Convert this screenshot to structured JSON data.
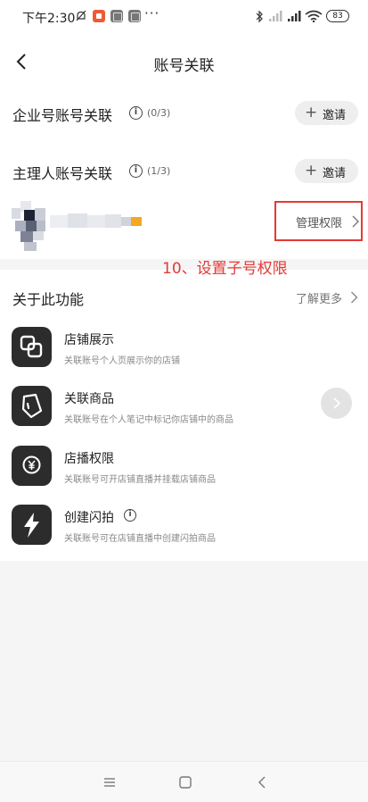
{
  "status_bar": {
    "time": "下午2:30",
    "more": "···",
    "battery": "83"
  },
  "header": {
    "title": "账号关联"
  },
  "enterprise": {
    "title": "企业号账号关联",
    "count": "(0/3)",
    "invite_label": "邀请"
  },
  "manager": {
    "title": "主理人账号关联",
    "count": "(1/3)",
    "invite_label": "邀请",
    "manage_label": "管理权限"
  },
  "annotation": "10、设置子号权限",
  "about": {
    "title": "关于此功能",
    "learn_more": "了解更多",
    "features": [
      {
        "title": "店铺展示",
        "desc": "关联账号个人页展示你的店铺",
        "icon": "overlapping-squares-icon"
      },
      {
        "title": "关联商品",
        "desc": "关联账号在个人笔记中标记你店铺中的商品",
        "icon": "tag-icon"
      },
      {
        "title": "店播权限",
        "desc": "关联账号可开店铺直播并挂载店铺商品",
        "icon": "yen-coin-icon"
      },
      {
        "title": "创建闪拍",
        "desc": "关联账号可在店铺直播中创建闪拍商品",
        "icon": "lightning-icon"
      }
    ]
  },
  "colors": {
    "highlight_border": "#e53935",
    "annotation_text": "#e53935",
    "feature_icon_bg": "#2c2c2c",
    "avatar_badge": "#f5a623"
  }
}
